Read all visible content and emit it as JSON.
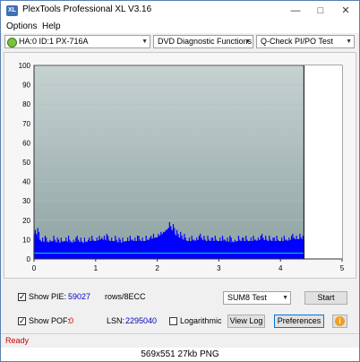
{
  "window": {
    "title": "PlexTools Professional XL V3.16",
    "icon_text": "XL"
  },
  "menu": [
    "Options",
    "Help"
  ],
  "toolbar": {
    "drive": "HA:0 ID:1  PX-716A",
    "function": "DVD Diagnostic Functions",
    "test": "Q-Check PI/PO Test"
  },
  "chart_data": {
    "type": "area",
    "title": "",
    "xlabel": "",
    "ylabel": "",
    "xlim": [
      0,
      5
    ],
    "ylim": [
      0,
      100
    ],
    "x_ticks": [
      "0",
      "1",
      "2",
      "3",
      "4",
      "5"
    ],
    "y_ticks": [
      "0",
      "10",
      "20",
      "30",
      "40",
      "50",
      "60",
      "70",
      "80",
      "90",
      "100"
    ],
    "end_marker_x": 4.38,
    "colors": {
      "pie": "#0000ff",
      "pof": "#00c0c0",
      "background": "#a8b8b8"
    },
    "series": [
      {
        "x": [
          0,
          0.1,
          0.2,
          0.3,
          0.4,
          0.5,
          0.6,
          0.7,
          0.8,
          0.9,
          1.0,
          1.1,
          1.2,
          1.3,
          1.4,
          1.5,
          1.6,
          1.7,
          1.8,
          1.9,
          2.0,
          2.1,
          2.2,
          2.3,
          2.4,
          2.5,
          2.6,
          2.7,
          2.8,
          2.9,
          3.0,
          3.1,
          3.2,
          3.3,
          3.4,
          3.5,
          3.6,
          3.7,
          3.8,
          3.9,
          4.0,
          4.1,
          4.2,
          4.3,
          4.38
        ],
        "values": [
          13,
          9,
          8,
          9,
          8,
          9,
          8,
          9,
          8,
          9,
          9,
          10,
          9,
          9,
          8,
          9,
          9,
          9,
          9,
          10,
          11,
          13,
          16,
          12,
          10,
          9,
          9,
          10,
          9,
          9,
          9,
          9,
          8,
          9,
          9,
          9,
          9,
          10,
          9,
          9,
          9,
          9,
          10,
          10,
          10
        ]
      },
      {
        "x": [
          0,
          0.5,
          1.0,
          1.5,
          2.0,
          2.5,
          3.0,
          3.5,
          4.0,
          4.38
        ],
        "values": [
          3,
          3,
          3,
          3,
          3,
          3,
          3,
          3,
          3,
          3
        ]
      }
    ]
  },
  "controls": {
    "show_pie_label": "Show PIE:",
    "pie_value": "59027",
    "rows_label": "rows/8ECC",
    "show_pof_label": "Show POF:",
    "pof_value": "0",
    "lsn_label": "LSN:",
    "lsn_value": "2295040",
    "logarithmic_label": "Logarithmic",
    "test_select": "SUM8 Test",
    "start_button": "Start",
    "view_log_button": "View Log",
    "preferences_button": "Preferences",
    "info_icon": "info-icon",
    "show_pie_checked": true,
    "show_pof_checked": true,
    "logarithmic_checked": false
  },
  "status": "Ready",
  "caption": "569x551  27kb  PNG"
}
